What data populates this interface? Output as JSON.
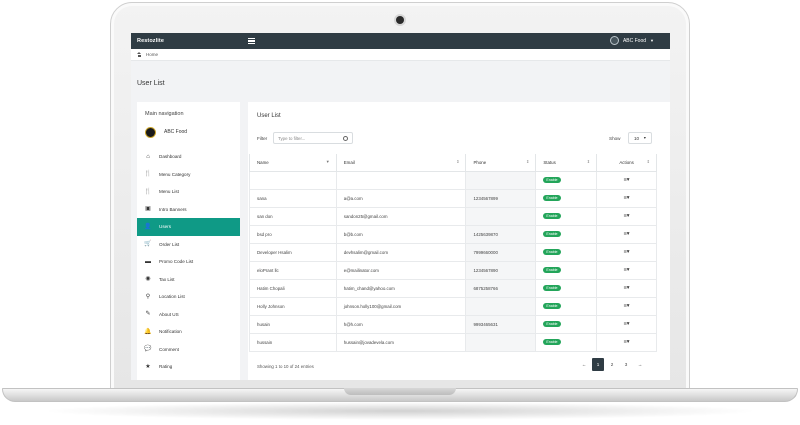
{
  "app": {
    "brand": "Restozlite",
    "user_name": "ABC Food"
  },
  "breadcrumb": {
    "home": "Home"
  },
  "page": {
    "title": "User List"
  },
  "sidebar": {
    "heading": "Main navigation",
    "brand_name": "ABC Food",
    "items": [
      {
        "label": "Dashboard",
        "icon": "home-icon",
        "glyph": "⌂",
        "active": false
      },
      {
        "label": "Menu Category",
        "icon": "cutlery-icon",
        "glyph": "🍴",
        "active": false
      },
      {
        "label": "Menu List",
        "icon": "cutlery-icon",
        "glyph": "🍴",
        "active": false
      },
      {
        "label": "Intro Banners",
        "icon": "image-icon",
        "glyph": "▣",
        "active": false
      },
      {
        "label": "Users",
        "icon": "user-icon",
        "glyph": "👤",
        "active": true
      },
      {
        "label": "Order List",
        "icon": "cart-icon",
        "glyph": "🛒",
        "active": false
      },
      {
        "label": "Promo Code List",
        "icon": "ticket-icon",
        "glyph": "▬",
        "active": false
      },
      {
        "label": "Tax List",
        "icon": "tax-icon",
        "glyph": "◉",
        "active": false
      },
      {
        "label": "Location List",
        "icon": "pin-icon",
        "glyph": "⚲",
        "active": false
      },
      {
        "label": "About US",
        "icon": "edit-icon",
        "glyph": "✎",
        "active": false
      },
      {
        "label": "Notification",
        "icon": "bell-icon",
        "glyph": "🔔",
        "active": false
      },
      {
        "label": "Comment",
        "icon": "comment-icon",
        "glyph": "💬",
        "active": false
      },
      {
        "label": "Rating",
        "icon": "star-icon",
        "glyph": "★",
        "active": false
      }
    ]
  },
  "main": {
    "card_title": "User List",
    "filter_label": "Filter",
    "filter_placeholder": "Type to filter...",
    "show_label": "Show",
    "show_value": "10",
    "columns": [
      "Name",
      "Email",
      "Phone",
      "Status",
      "Actions"
    ],
    "rows": [
      {
        "name": "",
        "email": "",
        "phone": "",
        "status": "Enable"
      },
      {
        "name": "sana",
        "email": "a@a.com",
        "phone": "1234567899",
        "status": "Enable"
      },
      {
        "name": "san don",
        "email": "sandon25@gmail.com",
        "phone": "",
        "status": "Enable"
      },
      {
        "name": "bsd pro",
        "email": "b@b.com",
        "phone": "1425639870",
        "status": "Enable"
      },
      {
        "name": "Developer Hsalim",
        "email": "devhsalim@gmail.com",
        "phone": "7999660000",
        "status": "Enable"
      },
      {
        "name": "eloPrant llc",
        "email": "e@mailinator.com",
        "phone": "1234567890",
        "status": "Enable"
      },
      {
        "name": "Hatim Chopali",
        "email": "hatim_chand@yahoo.com",
        "phone": "6875258766",
        "status": "Enable"
      },
      {
        "name": "Holly Johnson",
        "email": "johnson.holly100@gmail.com",
        "phone": "",
        "status": "Enable"
      },
      {
        "name": "husain",
        "email": "h@h.com",
        "phone": "9993465631",
        "status": "Enable"
      },
      {
        "name": "hussain",
        "email": "hussain@jovadevela.com",
        "phone": "",
        "status": "Enable"
      }
    ],
    "footer_info": "Showing 1 to 10 of 24 entries",
    "pager": [
      "←",
      "1",
      "2",
      "3",
      "→"
    ],
    "pager_active": "1"
  }
}
